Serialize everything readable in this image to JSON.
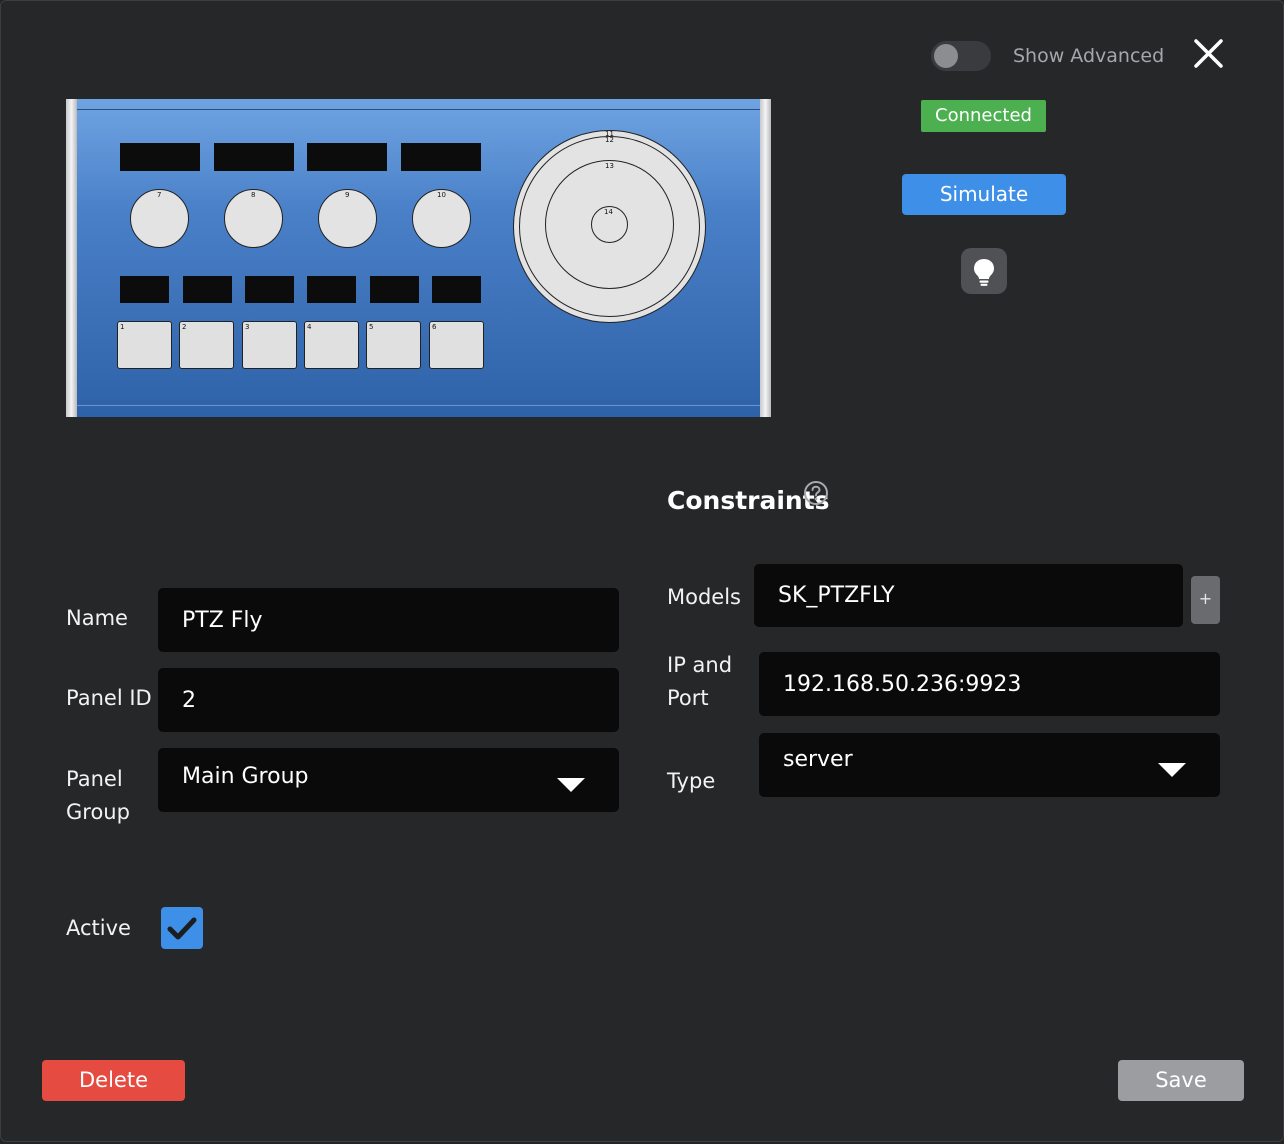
{
  "header": {
    "show_advanced_label": "Show Advanced",
    "show_advanced_on": false,
    "close_icon": "close-icon"
  },
  "status": {
    "connection_label": "Connected",
    "connection_color": "#4caf50"
  },
  "actions": {
    "simulate_label": "Simulate",
    "identify_icon": "lightbulb-icon",
    "delete_label": "Delete",
    "save_label": "Save"
  },
  "panel_preview": {
    "knob_labels": [
      "7",
      "8",
      "9",
      "10"
    ],
    "key_labels": [
      "1",
      "2",
      "3",
      "4",
      "5",
      "6"
    ],
    "joystick_labels": [
      "11",
      "12",
      "13",
      "14"
    ]
  },
  "form": {
    "name_label": "Name",
    "name_value": "PTZ Fly",
    "panel_id_label": "Panel ID",
    "panel_id_value": "2",
    "panel_group_label_line1": "Panel",
    "panel_group_label_line2": "Group",
    "panel_group_value": "Main Group",
    "active_label": "Active",
    "active_checked": true
  },
  "constraints": {
    "title": "Constraints",
    "help_icon": "help-circle-icon",
    "models_label": "Models",
    "models_value": "SK_PTZFLY",
    "add_label": "+",
    "ip_label_line1": "IP and",
    "ip_label_line2": "Port",
    "ip_value": "192.168.50.236:9923",
    "type_label": "Type",
    "type_value": "server"
  },
  "colors": {
    "accent": "#3e8fe8",
    "danger": "#e54b40",
    "background": "#262729",
    "field": "#0a0a0a"
  }
}
